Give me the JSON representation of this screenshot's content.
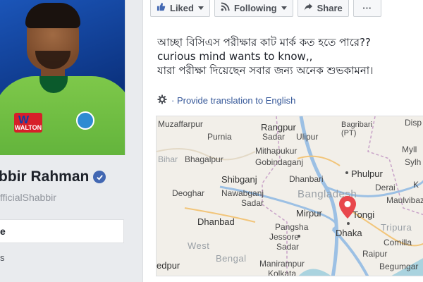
{
  "profile": {
    "name": "bbir Rahman",
    "handle": "fficialShabbir",
    "nav_selected": "e",
    "nav_item": "s"
  },
  "post": {
    "actions": {
      "liked": "Liked",
      "following": "Following",
      "share": "Share",
      "more": "···"
    },
    "text_lines": [
      "আচ্ছা বিসিএস পরীক্ষার কাট মার্ক কত হতে পারে??",
      "curious mind wants to know,,",
      "যারা পরীক্ষা দিয়েছেন সবার জন্য অনেক শুভকামনা।"
    ],
    "translate": "· Provide translation to English"
  },
  "map": {
    "labels": {
      "muzaffarpur": "Muzaffarpur",
      "rangpur": "Rangpur",
      "bagribari": "Bagribari",
      "pt": "(PT)",
      "dispur": "Disp",
      "purnia": "Purnia",
      "saidpur": "Sadar",
      "ulipur": "Ulipur",
      "bihar": "Bihar",
      "bhagalpur": "Bhagalpur",
      "mithapukur": "Mithapukur",
      "gobindaganj": "Gobindaganj",
      "myli": "Myll",
      "sylhet": "Sylh",
      "phulpur": "Phulpur",
      "shibganj": "Shibganj",
      "dhanbari": "Dhanbari",
      "bangladesh": "Bangladesh",
      "deoghar": "Deoghar",
      "nawabganj": "Nawabganj",
      "nawabganj2": "Sadar",
      "derai": "Derai",
      "kalij": "K",
      "moulvibazar": "Maulvibaza",
      "dhanbad": "Dhanbad",
      "mirpur": "Mirpur",
      "tongi": "Tongi",
      "pangsha": "Pangsha",
      "jessore": "Jessore",
      "sadar": "Sadar",
      "dhaka": "Dhaka",
      "tripura": "Tripura",
      "comilla": "Comilla",
      "west": "West",
      "bengal": "Bengal",
      "raipur": "Raipur",
      "edpur": "edpur",
      "manirampur": "Manirampur",
      "kolkata": "Kolkata",
      "begumgan": "Begumgar"
    }
  }
}
